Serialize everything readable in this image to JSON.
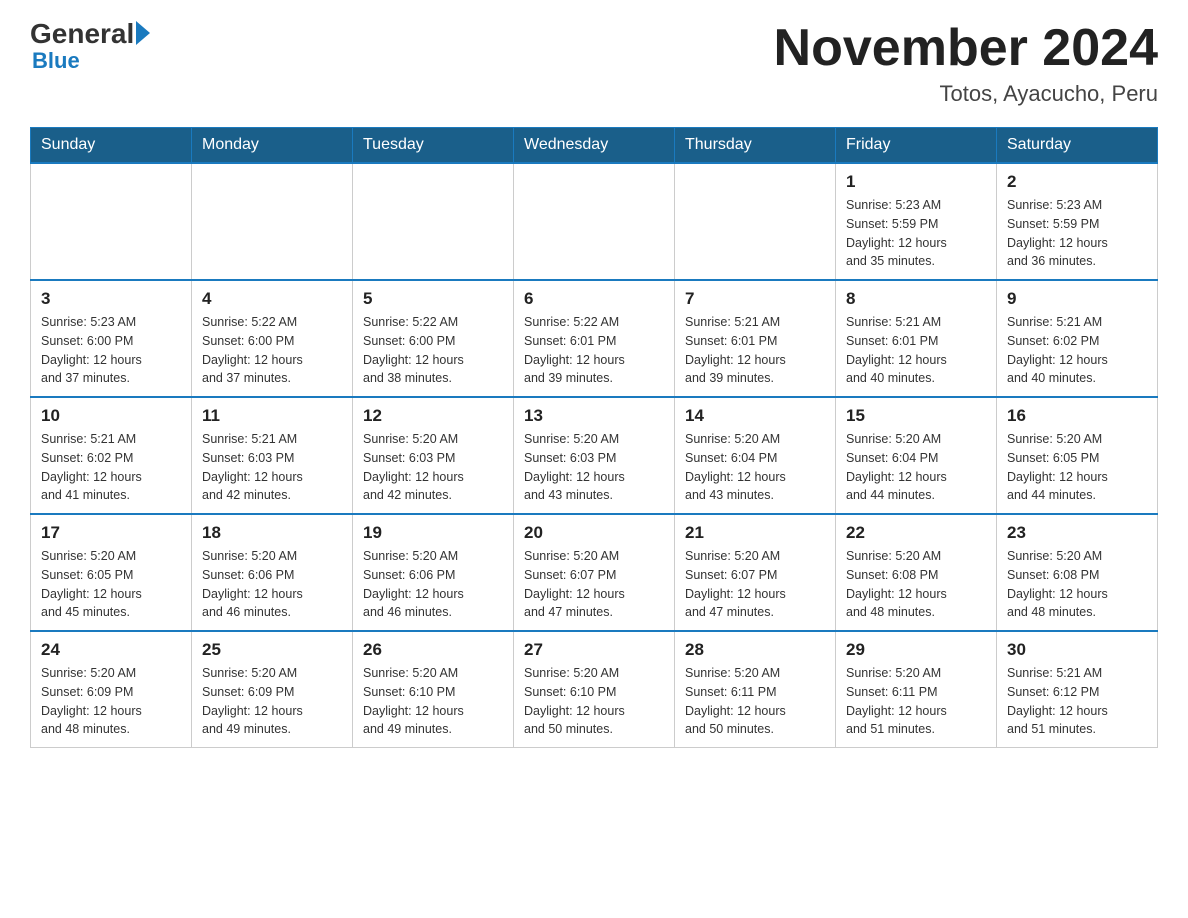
{
  "header": {
    "logo_text": "General",
    "logo_blue": "Blue",
    "month_title": "November 2024",
    "location": "Totos, Ayacucho, Peru"
  },
  "days_of_week": [
    "Sunday",
    "Monday",
    "Tuesday",
    "Wednesday",
    "Thursday",
    "Friday",
    "Saturday"
  ],
  "weeks": [
    [
      {
        "day": "",
        "info": ""
      },
      {
        "day": "",
        "info": ""
      },
      {
        "day": "",
        "info": ""
      },
      {
        "day": "",
        "info": ""
      },
      {
        "day": "",
        "info": ""
      },
      {
        "day": "1",
        "info": "Sunrise: 5:23 AM\nSunset: 5:59 PM\nDaylight: 12 hours\nand 35 minutes."
      },
      {
        "day": "2",
        "info": "Sunrise: 5:23 AM\nSunset: 5:59 PM\nDaylight: 12 hours\nand 36 minutes."
      }
    ],
    [
      {
        "day": "3",
        "info": "Sunrise: 5:23 AM\nSunset: 6:00 PM\nDaylight: 12 hours\nand 37 minutes."
      },
      {
        "day": "4",
        "info": "Sunrise: 5:22 AM\nSunset: 6:00 PM\nDaylight: 12 hours\nand 37 minutes."
      },
      {
        "day": "5",
        "info": "Sunrise: 5:22 AM\nSunset: 6:00 PM\nDaylight: 12 hours\nand 38 minutes."
      },
      {
        "day": "6",
        "info": "Sunrise: 5:22 AM\nSunset: 6:01 PM\nDaylight: 12 hours\nand 39 minutes."
      },
      {
        "day": "7",
        "info": "Sunrise: 5:21 AM\nSunset: 6:01 PM\nDaylight: 12 hours\nand 39 minutes."
      },
      {
        "day": "8",
        "info": "Sunrise: 5:21 AM\nSunset: 6:01 PM\nDaylight: 12 hours\nand 40 minutes."
      },
      {
        "day": "9",
        "info": "Sunrise: 5:21 AM\nSunset: 6:02 PM\nDaylight: 12 hours\nand 40 minutes."
      }
    ],
    [
      {
        "day": "10",
        "info": "Sunrise: 5:21 AM\nSunset: 6:02 PM\nDaylight: 12 hours\nand 41 minutes."
      },
      {
        "day": "11",
        "info": "Sunrise: 5:21 AM\nSunset: 6:03 PM\nDaylight: 12 hours\nand 42 minutes."
      },
      {
        "day": "12",
        "info": "Sunrise: 5:20 AM\nSunset: 6:03 PM\nDaylight: 12 hours\nand 42 minutes."
      },
      {
        "day": "13",
        "info": "Sunrise: 5:20 AM\nSunset: 6:03 PM\nDaylight: 12 hours\nand 43 minutes."
      },
      {
        "day": "14",
        "info": "Sunrise: 5:20 AM\nSunset: 6:04 PM\nDaylight: 12 hours\nand 43 minutes."
      },
      {
        "day": "15",
        "info": "Sunrise: 5:20 AM\nSunset: 6:04 PM\nDaylight: 12 hours\nand 44 minutes."
      },
      {
        "day": "16",
        "info": "Sunrise: 5:20 AM\nSunset: 6:05 PM\nDaylight: 12 hours\nand 44 minutes."
      }
    ],
    [
      {
        "day": "17",
        "info": "Sunrise: 5:20 AM\nSunset: 6:05 PM\nDaylight: 12 hours\nand 45 minutes."
      },
      {
        "day": "18",
        "info": "Sunrise: 5:20 AM\nSunset: 6:06 PM\nDaylight: 12 hours\nand 46 minutes."
      },
      {
        "day": "19",
        "info": "Sunrise: 5:20 AM\nSunset: 6:06 PM\nDaylight: 12 hours\nand 46 minutes."
      },
      {
        "day": "20",
        "info": "Sunrise: 5:20 AM\nSunset: 6:07 PM\nDaylight: 12 hours\nand 47 minutes."
      },
      {
        "day": "21",
        "info": "Sunrise: 5:20 AM\nSunset: 6:07 PM\nDaylight: 12 hours\nand 47 minutes."
      },
      {
        "day": "22",
        "info": "Sunrise: 5:20 AM\nSunset: 6:08 PM\nDaylight: 12 hours\nand 48 minutes."
      },
      {
        "day": "23",
        "info": "Sunrise: 5:20 AM\nSunset: 6:08 PM\nDaylight: 12 hours\nand 48 minutes."
      }
    ],
    [
      {
        "day": "24",
        "info": "Sunrise: 5:20 AM\nSunset: 6:09 PM\nDaylight: 12 hours\nand 48 minutes."
      },
      {
        "day": "25",
        "info": "Sunrise: 5:20 AM\nSunset: 6:09 PM\nDaylight: 12 hours\nand 49 minutes."
      },
      {
        "day": "26",
        "info": "Sunrise: 5:20 AM\nSunset: 6:10 PM\nDaylight: 12 hours\nand 49 minutes."
      },
      {
        "day": "27",
        "info": "Sunrise: 5:20 AM\nSunset: 6:10 PM\nDaylight: 12 hours\nand 50 minutes."
      },
      {
        "day": "28",
        "info": "Sunrise: 5:20 AM\nSunset: 6:11 PM\nDaylight: 12 hours\nand 50 minutes."
      },
      {
        "day": "29",
        "info": "Sunrise: 5:20 AM\nSunset: 6:11 PM\nDaylight: 12 hours\nand 51 minutes."
      },
      {
        "day": "30",
        "info": "Sunrise: 5:21 AM\nSunset: 6:12 PM\nDaylight: 12 hours\nand 51 minutes."
      }
    ]
  ]
}
